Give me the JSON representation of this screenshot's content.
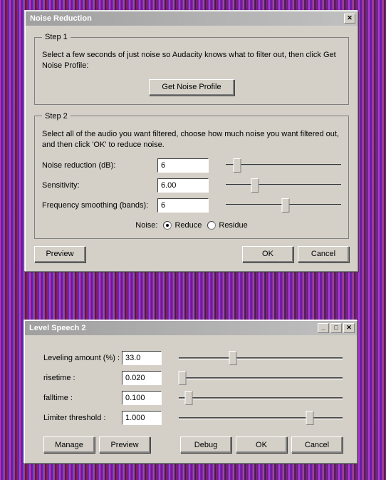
{
  "noise_reduction": {
    "title": "Noise Reduction",
    "step1": {
      "legend": "Step 1",
      "instructions": "Select a few seconds of just noise so Audacity knows what to filter out, then click Get Noise Profile:",
      "get_profile_btn": "Get Noise Profile"
    },
    "step2": {
      "legend": "Step 2",
      "instructions": "Select all of the audio you want filtered, choose how much noise you want filtered out, and then click 'OK' to reduce noise.",
      "noise_reduction_label": "Noise reduction (dB):",
      "noise_reduction_value": "6",
      "sensitivity_label": "Sensitivity:",
      "sensitivity_value": "6.00",
      "freq_smoothing_label": "Frequency smoothing (bands):",
      "freq_smoothing_value": "6",
      "noise_label": "Noise:",
      "reduce_label": "Reduce",
      "residue_label": "Residue"
    },
    "preview_btn": "Preview",
    "ok_btn": "OK",
    "cancel_btn": "Cancel"
  },
  "level_speech": {
    "title": "Level Speech 2",
    "leveling_amount_label": "Leveling amount (%) :",
    "leveling_amount_value": "33.0",
    "risetime_label": "risetime :",
    "risetime_value": "0.020",
    "falltime_label": "falltime :",
    "falltime_value": "0.100",
    "limiter_label": "Limiter threshold :",
    "limiter_value": "1.000",
    "manage_btn": "Manage",
    "preview_btn": "Preview",
    "debug_btn": "Debug",
    "ok_btn": "OK",
    "cancel_btn": "Cancel"
  },
  "slider_positions": {
    "nr_noise_reduction": 10,
    "nr_sensitivity": 25,
    "nr_freq_smoothing": 52,
    "ls_leveling": 33,
    "ls_risetime": 2,
    "ls_falltime": 6,
    "ls_limiter": 80
  }
}
